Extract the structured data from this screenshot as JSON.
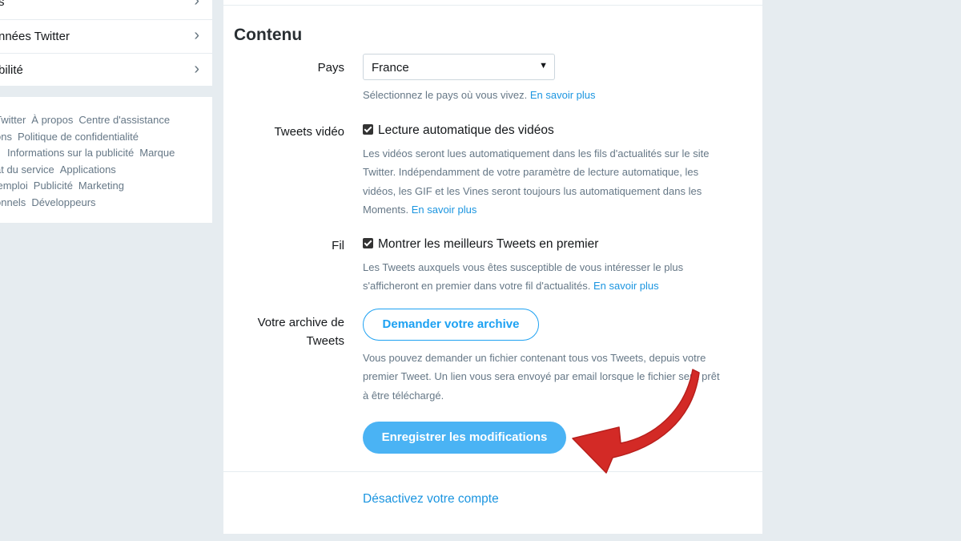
{
  "sidebar": {
    "items": [
      {
        "label": "s",
        "chevron": "›"
      },
      {
        "label": "nnées Twitter",
        "chevron": "›"
      },
      {
        "label": "bilité",
        "chevron": "›"
      }
    ],
    "footer_rows": [
      [
        "Twitter",
        "À propos",
        "Centre d'assistance"
      ],
      [
        "ons",
        "Politique de confidentialité"
      ],
      [
        "Informations sur la publicité",
        "Marque"
      ],
      [
        "at du service",
        "Applications"
      ],
      [
        "'emploi",
        "Publicité",
        "Marketing"
      ],
      [
        "onnels",
        "Développeurs"
      ]
    ]
  },
  "main": {
    "section_title": "Contenu",
    "country": {
      "label": "Pays",
      "value": "France",
      "help_text": "Sélectionnez le pays où vous vivez.",
      "help_link": "En savoir plus"
    },
    "video": {
      "label": "Tweets vidéo",
      "checkbox_label": "Lecture automatique des vidéos",
      "checked": true,
      "help_lines": [
        "Les vidéos seront lues automatiquement dans les fils d'actualités sur le site",
        "Twitter. Indépendamment de votre paramètre de lecture automatique, les",
        "vidéos, les GIF et les Vines seront toujours lus automatiquement dans les"
      ],
      "help_last": "Moments.",
      "help_link": "En savoir plus"
    },
    "timeline": {
      "label": "Fil",
      "checkbox_label": "Montrer les meilleurs Tweets en premier",
      "checked": true,
      "help_line1": "Les Tweets auxquels vous êtes susceptible de vous intéresser le plus",
      "help_line2": "s'afficheront en premier dans votre fil d'actualités.",
      "help_link": "En savoir plus"
    },
    "archive": {
      "label_line1": "Votre archive de",
      "label_line2": "Tweets",
      "button": "Demander votre archive",
      "help_lines": [
        "Vous pouvez demander un fichier contenant tous vos Tweets, depuis votre",
        "premier Tweet. Un lien vous sera envoyé par email lorsque le fichier sera prêt",
        "à être téléchargé."
      ]
    },
    "save_button": "Enregistrer les modifications",
    "deactivate_link": "Désactivez votre compte"
  },
  "colors": {
    "accent": "#1da1f2",
    "link": "#1b95e0",
    "primary_button": "#4ab3f4",
    "annotation_arrow": "#d32a26",
    "background": "#e6ecf0"
  },
  "icons": [
    "chevron-right-icon",
    "caret-down-icon",
    "checkbox-checked-icon",
    "red-arrow-annotation"
  ]
}
